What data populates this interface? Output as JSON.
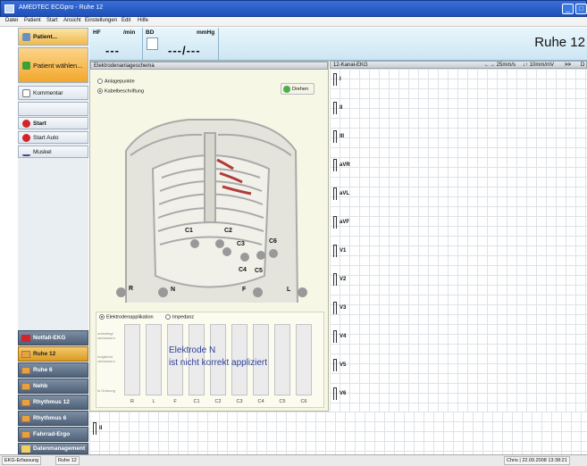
{
  "window": {
    "title": "AMEDTEC ECGpro  -  Ruhe 12"
  },
  "menu": [
    "Datei",
    "Patient",
    "Start",
    "Ansicht",
    "Einstellungen",
    "Edit",
    "Hilfe"
  ],
  "sidebar": {
    "patient_label": "Patient...",
    "patient_select_label": "Patient wählen...",
    "comment_label": "Kommentar",
    "start_label": "Start",
    "start_auto_label": "Start Auto",
    "muscle_label": "Muskel",
    "nav": [
      "Notfall-EKG",
      "Ruhe 12",
      "Ruhe 6",
      "Nehb",
      "Rhythmus 12",
      "Rhythmus 6",
      "Fahrrad-Ergo",
      "Datenmanagement"
    ]
  },
  "vitals": {
    "hf_label": "HF",
    "hf_unit": "/min",
    "hf_value": "---",
    "bd_label": "BD",
    "bd_unit": "mmHg",
    "bd_value": "---/---",
    "mode_title": "Ruhe 12"
  },
  "electrode_panel": {
    "title": "Elektrodenanlageschema",
    "option_points": "Anlagepunkte",
    "option_cable": "Kabelbeschriftung",
    "rotate_label": "Drehen",
    "electrodes": [
      "C1",
      "C2",
      "C3",
      "C6",
      "C4",
      "C5",
      "R",
      "N",
      "F",
      "L"
    ],
    "tab_application": "Elektrodenapplikation",
    "tab_impedance": "Impedanz",
    "scale_top": "unbedingt verbessern",
    "scale_mid": "möglichst verbessern",
    "scale_low": "in Ordnung",
    "bar_labels": [
      "R",
      "L",
      "F",
      "C1",
      "C2",
      "C3",
      "C4",
      "C5",
      "C6"
    ],
    "message_line1": "Elektrode N",
    "message_line2": "ist nicht korrekt appliziert"
  },
  "ekg_panel": {
    "title": "12-Kanal-EKG",
    "speed": "25mm/s",
    "amplitude": "10mm/mV",
    "nav_label": "D",
    "leads": [
      "I",
      "II",
      "III",
      "aVR",
      "aVL",
      "aVF",
      "V1",
      "V2",
      "V3",
      "V4",
      "V5",
      "V6"
    ]
  },
  "rhythm_lead": "II",
  "status": {
    "left1": "EKG-Erfassung",
    "left2": "Ruhe 12",
    "right": "Chris | 22.09.2008 13:38:21"
  }
}
